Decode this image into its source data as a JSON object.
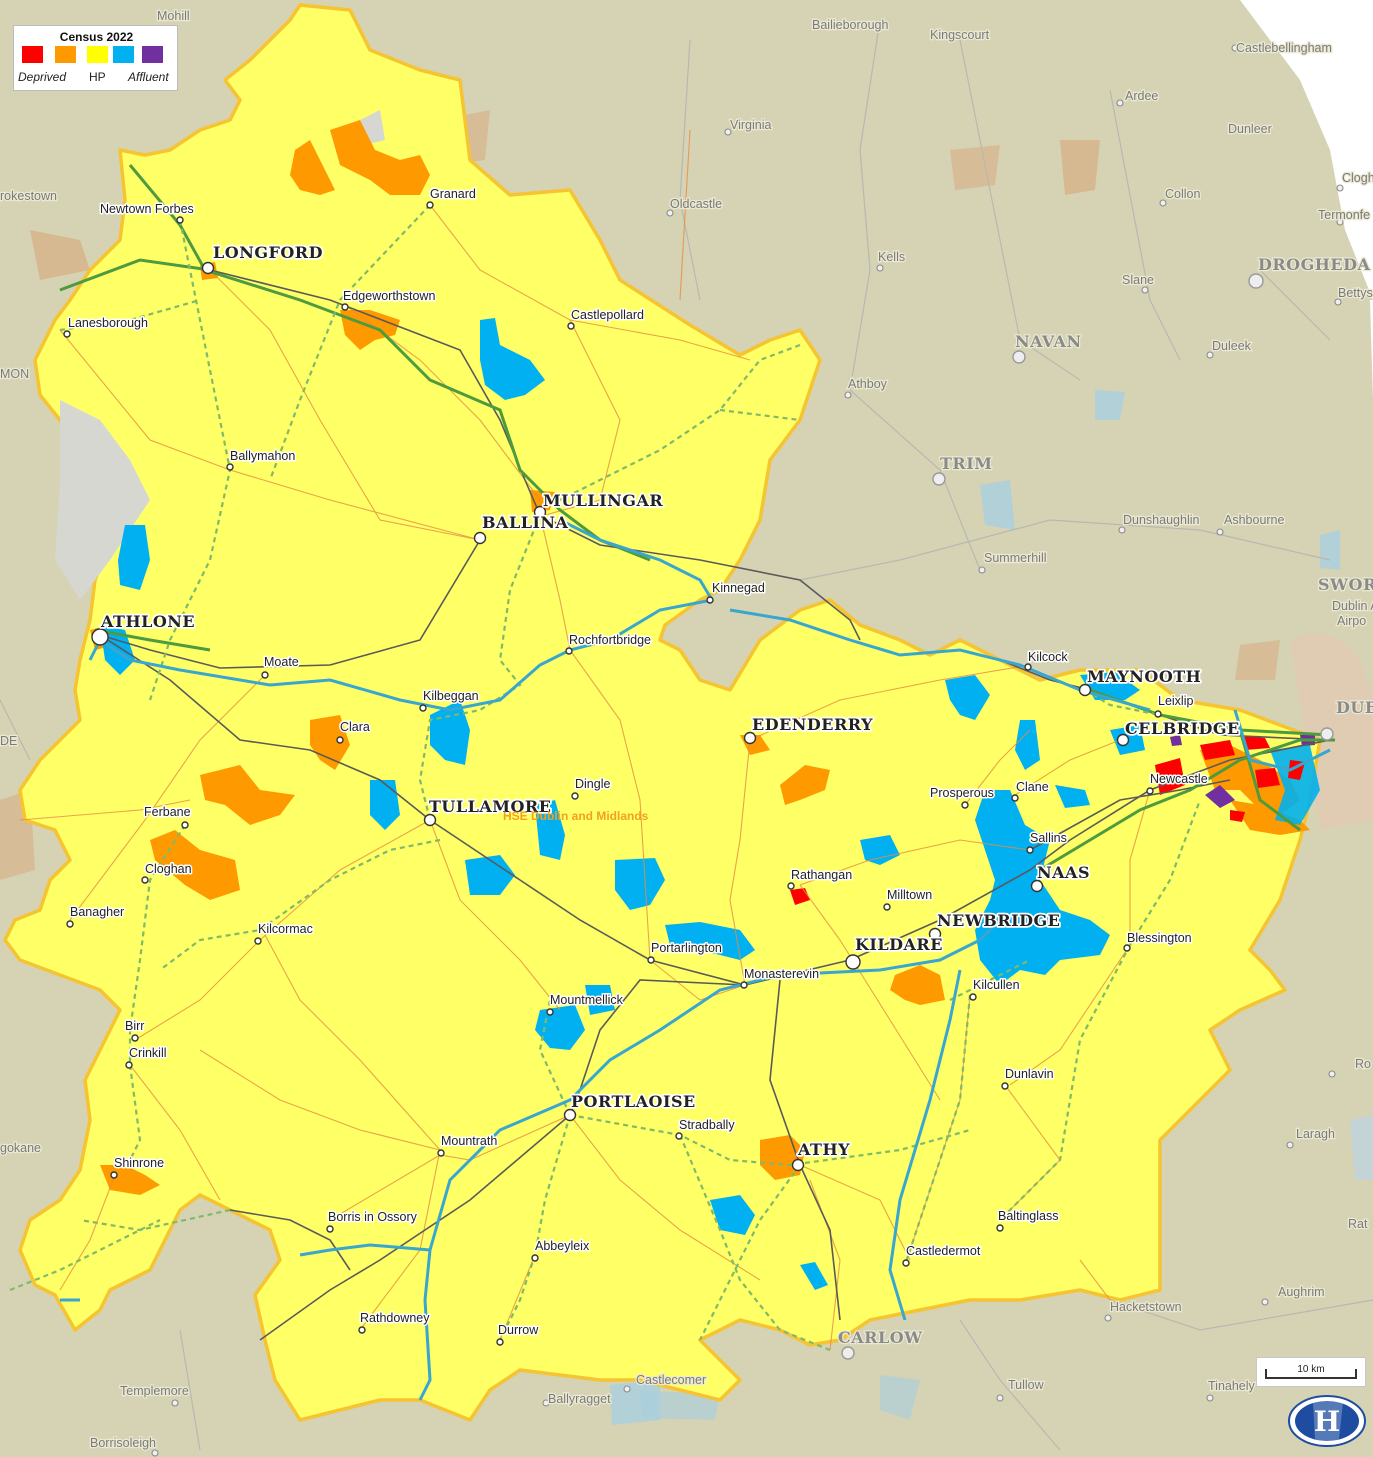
{
  "legend": {
    "title": "Census 2022",
    "swatches": [
      {
        "name": "deprived",
        "color": "#ff0000"
      },
      {
        "name": "marginally-below",
        "color": "#ff9900"
      },
      {
        "name": "hp",
        "color": "#ffff00"
      },
      {
        "name": "marginally-above",
        "color": "#00b0f0"
      },
      {
        "name": "affluent",
        "color": "#7030a0"
      }
    ],
    "label_deprived": "Deprived",
    "label_hp": "HP",
    "label_affluent": "Affluent"
  },
  "region": {
    "label": "HSE Dublin and Midlands",
    "fill": "#ffff66",
    "border": "#f5c430"
  },
  "towns": {
    "longford": "LONGFORD",
    "mullingar": "MULLINGAR",
    "ballina": "BALLINA",
    "athlone": "ATHLONE",
    "tullamore": "TULLAMORE",
    "edenderry": "EDENDERRY",
    "maynooth": "MAYNOOTH",
    "celbridge": "CELBRIDGE",
    "naas": "NAAS",
    "newbridge": "NEWBRIDGE",
    "kildare": "KILDARE",
    "portlaoise": "PORTLAOISE",
    "athy": "ATHY",
    "granard": "Granard",
    "newtown_forbes": "Newtown Forbes",
    "edgeworthstown": "Edgeworthstown",
    "lanesborough": "Lanesborough",
    "castlepollard": "Castlepollard",
    "ballymahon": "Ballymahon",
    "kinnegad": "Kinnegad",
    "rochfortbridge": "Rochfortbridge",
    "moate": "Moate",
    "kilbeggan": "Kilbeggan",
    "clara": "Clara",
    "dingle": "Dingle",
    "ferbane": "Ferbane",
    "cloghan": "Cloghan",
    "banagher": "Banagher",
    "kilcormac": "Kilcormac",
    "birr": "Birr",
    "crinkill": "Crinkill",
    "shinrone": "Shinrone",
    "kilcock": "Kilcock",
    "leixlip": "Leixlip",
    "newcastle": "Newcastle",
    "prosperous": "Prosperous",
    "clane": "Clane",
    "sallins": "Sallins",
    "rathangan": "Rathangan",
    "milltown": "Milltown",
    "blessington": "Blessington",
    "portarlington": "Portarlington",
    "monasterevin": "Monasterevin",
    "kilcullen": "Kilcullen",
    "mountmellick": "Mountmellick",
    "mountrath": "Mountrath",
    "stradbally": "Stradbally",
    "dunlavin": "Dunlavin",
    "borris_in_ossory": "Borris in Ossory",
    "abbeyleix": "Abbeyleix",
    "baltinglass": "Baltinglass",
    "castledermot": "Castledermot",
    "rathdowney": "Rathdowney",
    "durrow": "Durrow"
  },
  "external_labels": {
    "mohill": "Mohill",
    "bailieborough": "Bailieborough",
    "kingscourt": "Kingscourt",
    "castlebellingham": "Castlebellingham",
    "virginia": "Virginia",
    "ardee": "Ardee",
    "dunleer": "Dunleer",
    "rokestown": "rokestown",
    "oldcastle": "Oldcastle",
    "collon": "Collon",
    "clogh": "Clogh",
    "termonfe": "Termonfe",
    "kells": "Kells",
    "slane": "Slane",
    "drogheda": "DROGHEDA",
    "bettys": "Bettys",
    "mon": "MON",
    "navan": "NAVAN",
    "duleek": "Duleek",
    "athboy": "Athboy",
    "trim": "TRIM",
    "dunshaughlin": "Dunshaughlin",
    "ashbourne": "Ashbourne",
    "summerhill": "Summerhill",
    "sword": "SWORI",
    "dublin_airport": "Dublin Airpo",
    "dub": "DUB",
    "de": "DE",
    "ro": "Ro",
    "laragh": "Laragh",
    "rat": "Rat",
    "gokane": "gokane",
    "hacketstown": "Hacketstown",
    "aughrim": "Aughrim",
    "carlow": "CARLOW",
    "tullow": "Tullow",
    "tinahely": "Tinahely",
    "templemore": "Templemore",
    "castlecomer": "Castlecomer",
    "ballyragget": "Ballyragget",
    "borrisoleigh": "Borrisoleigh"
  },
  "scale": {
    "label": "10 km"
  },
  "logo": {
    "letter": "H"
  }
}
